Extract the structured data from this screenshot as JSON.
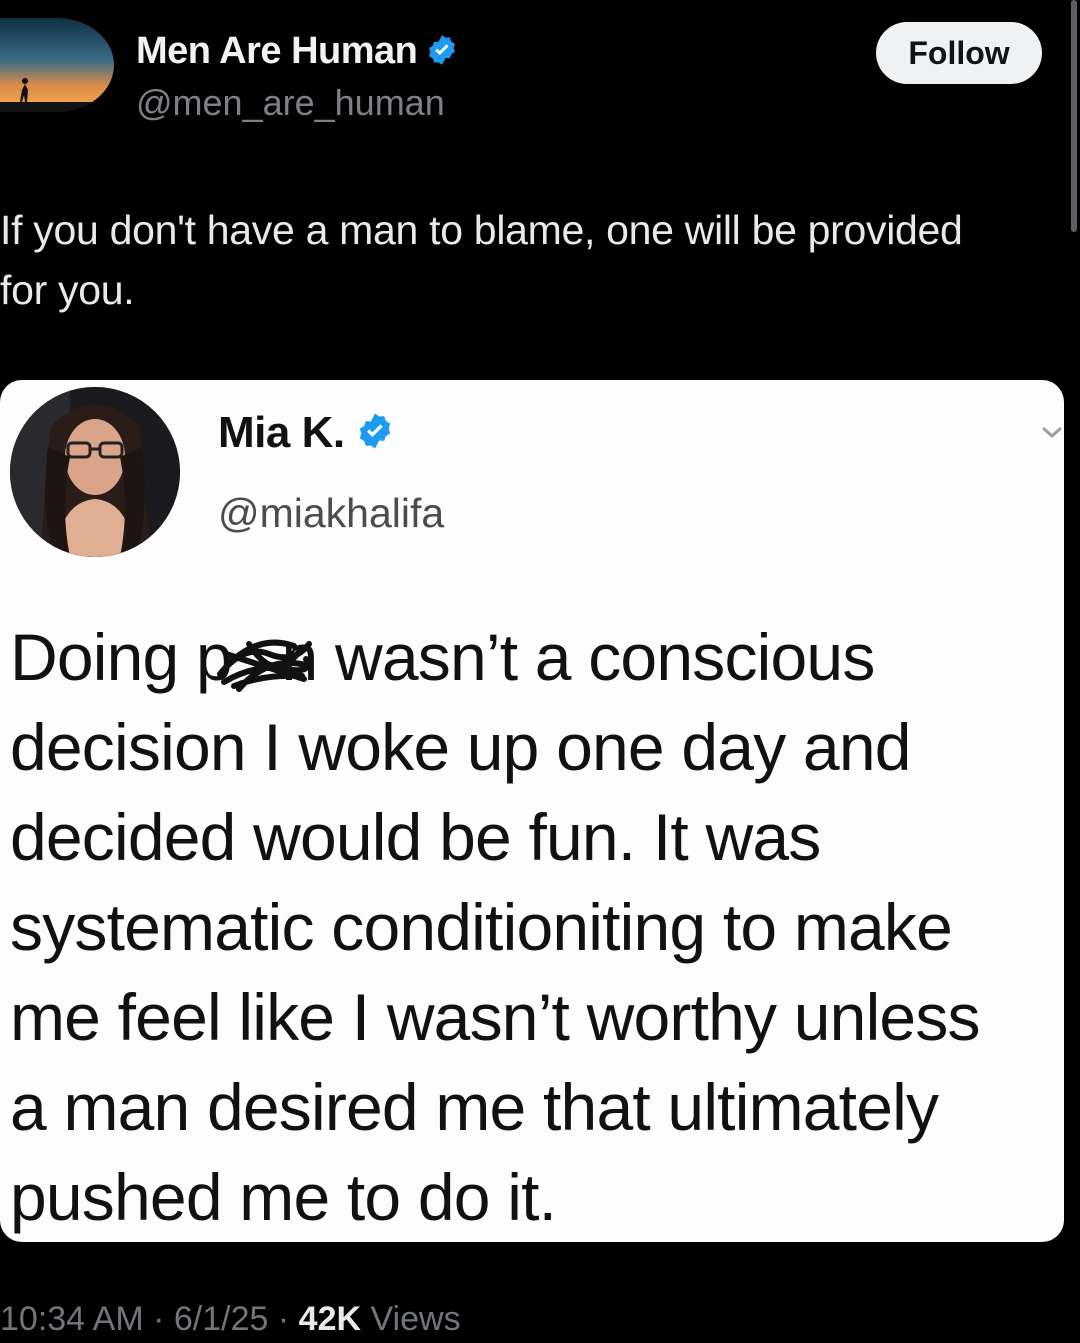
{
  "post": {
    "author_name": "Men Are Human",
    "author_handle": "@men_are_human",
    "follow_label": "Follow",
    "text_line1": "If you don't have a man to blame, one will be provided",
    "text_line2": "for you.",
    "time": "10:34 AM",
    "date": "6/1/25",
    "views_count": "42K",
    "views_label": "Views",
    "separator": "·"
  },
  "quoted": {
    "author_name": "Mia K.",
    "author_handle": "@miakhalifa",
    "lines": [
      "Doing p    n wasn’t a conscious",
      "decision I woke up one day and",
      "decided would be fun. It was",
      "systematic conditioniting to make",
      "me feel like I wasn’t worthy unless",
      "a man desired me that ultimately",
      "pushed me to do it."
    ]
  },
  "colors": {
    "background": "#000000",
    "verified": "#1d9bf0",
    "card": "#fdfdfd"
  },
  "icons": [
    "verified-badge-icon",
    "chevron-down-icon",
    "scribble-redaction"
  ]
}
